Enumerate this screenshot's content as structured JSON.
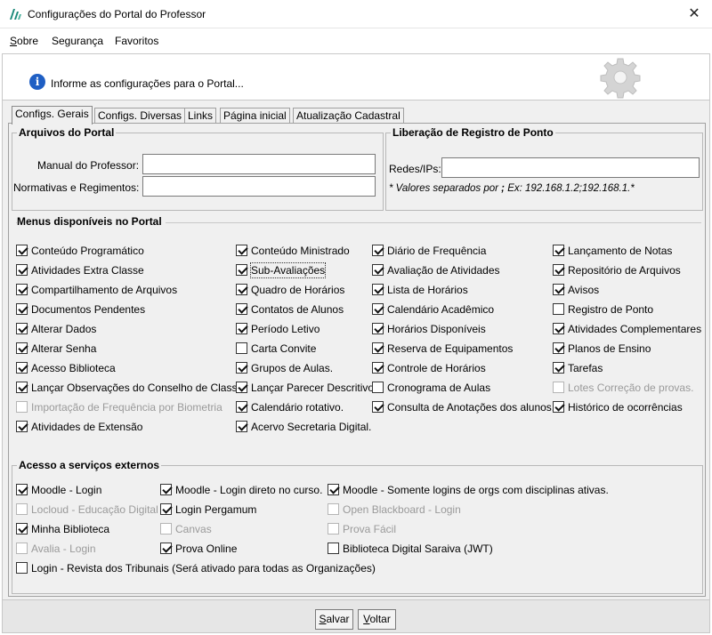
{
  "window": {
    "title": "Configurações do Portal do Professor",
    "close_glyph": "✕"
  },
  "menubar": {
    "items": [
      {
        "label": "Sobre",
        "accel": "S",
        "rest": "obre"
      },
      {
        "label": "Segurança"
      },
      {
        "label": "Favoritos"
      }
    ]
  },
  "info": {
    "icon": "info-icon",
    "text": "Informe as configurações para o Portal..."
  },
  "tabs": [
    {
      "label": "Configs. Gerais",
      "active": true
    },
    {
      "label": "Configs. Diversas"
    },
    {
      "label": "Links"
    },
    {
      "label": "Página inicial"
    },
    {
      "label": "Atualização Cadastral"
    }
  ],
  "arquivos": {
    "title": "Arquivos do Portal",
    "manual_label": "Manual do Professor:",
    "manual_value": "",
    "normativas_label": "Normativas e Regimentos:",
    "normativas_value": ""
  },
  "liberacao": {
    "title": "Liberação de Registro de Ponto",
    "redes_label": "Redes/IPs:",
    "redes_value": "",
    "hint_prefix": "* Valores separados por ",
    "hint_sep": ";",
    "hint_suffix": " Ex: 192.168.1.2;192.168.1.*"
  },
  "menus": {
    "title": "Menus disponíveis no Portal",
    "items": [
      {
        "label": "Conteúdo Programático",
        "checked": true
      },
      {
        "label": "Conteúdo Ministrado",
        "checked": true
      },
      {
        "label": "Diário de Frequência",
        "checked": true
      },
      {
        "label": "Lançamento de Notas",
        "checked": true
      },
      {
        "label": "Atividades Extra Classe",
        "checked": true
      },
      {
        "label": "Sub-Avaliações",
        "checked": true,
        "focused": true
      },
      {
        "label": "Avaliação de Atividades",
        "checked": true
      },
      {
        "label": "Repositório de Arquivos",
        "checked": true
      },
      {
        "label": "Compartilhamento de Arquivos",
        "checked": true
      },
      {
        "label": "Quadro de Horários",
        "checked": true
      },
      {
        "label": "Lista de Horários",
        "checked": true
      },
      {
        "label": "Avisos",
        "checked": true
      },
      {
        "label": "Documentos Pendentes",
        "checked": true
      },
      {
        "label": "Contatos de Alunos",
        "checked": true
      },
      {
        "label": "Calendário Acadêmico",
        "checked": true
      },
      {
        "label": "Registro de Ponto",
        "checked": false
      },
      {
        "label": "Alterar Dados",
        "checked": true
      },
      {
        "label": "Período Letivo",
        "checked": true
      },
      {
        "label": "Horários Disponíveis",
        "checked": true
      },
      {
        "label": "Atividades Complementares",
        "checked": true
      },
      {
        "label": "Alterar Senha",
        "checked": true
      },
      {
        "label": "Carta Convite",
        "checked": false
      },
      {
        "label": "Reserva de Equipamentos",
        "checked": true
      },
      {
        "label": "Planos de Ensino",
        "checked": true
      },
      {
        "label": "Acesso Biblioteca",
        "checked": true
      },
      {
        "label": "Grupos de Aulas.",
        "checked": true
      },
      {
        "label": "Controle de Horários",
        "checked": true
      },
      {
        "label": "Tarefas",
        "checked": true
      },
      {
        "label": "Lançar Observações do Conselho de Classe",
        "checked": true
      },
      {
        "label": "Lançar Parecer Descritivo",
        "checked": true
      },
      {
        "label": "Cronograma de Aulas",
        "checked": false
      },
      {
        "label": "Lotes Correção de provas.",
        "checked": false,
        "disabled": true
      },
      {
        "label": "Importação de Frequência por Biometria",
        "checked": false,
        "disabled": true
      },
      {
        "label": "Calendário rotativo.",
        "checked": true
      },
      {
        "label": "Consulta de Anotações dos alunos.",
        "checked": true
      },
      {
        "label": "Histórico de ocorrências",
        "checked": true
      },
      {
        "label": "Atividades de Extensão",
        "checked": true
      },
      {
        "label": "Acervo Secretaria Digital.",
        "checked": true
      }
    ]
  },
  "externos": {
    "title": "Acesso a serviços externos",
    "items": [
      {
        "label": "Moodle - Login",
        "checked": true
      },
      {
        "label": "Moodle - Login direto no curso.",
        "checked": true
      },
      {
        "label": "Moodle - Somente logins de orgs com disciplinas ativas.",
        "checked": true
      },
      {
        "label": "Locloud - Educação Digital",
        "checked": false,
        "disabled": true
      },
      {
        "label": "Login Pergamum",
        "checked": true
      },
      {
        "label": "Open Blackboard - Login",
        "checked": false,
        "disabled": true
      },
      {
        "label": "Minha Biblioteca",
        "checked": true
      },
      {
        "label": "Canvas",
        "checked": false,
        "disabled": true
      },
      {
        "label": "Prova Fácil",
        "checked": false,
        "disabled": true
      },
      {
        "label": "Avalia - Login",
        "checked": false,
        "disabled": true
      },
      {
        "label": "Prova Online",
        "checked": true
      },
      {
        "label": "Biblioteca Digital Saraiva (JWT)",
        "checked": false
      },
      {
        "label": "Login - Revista dos Tribunais (Será ativado para todas as Organizações)",
        "checked": false
      }
    ]
  },
  "buttons": {
    "salvar": {
      "label": "Salvar",
      "accel": "S",
      "rest": "alvar"
    },
    "voltar": {
      "label": "Voltar",
      "accel": "V",
      "rest": "oltar"
    }
  }
}
